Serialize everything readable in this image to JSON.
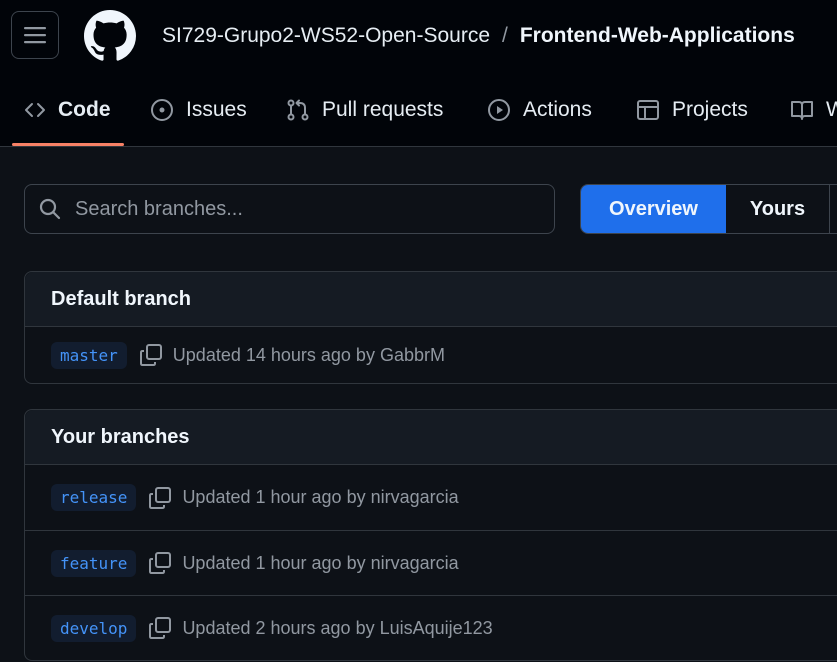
{
  "header": {
    "owner": "SI729-Grupo2-WS52-Open-Source",
    "separator": "/",
    "repo": "Frontend-Web-Applications",
    "menu_icon": "hamburger-icon",
    "logo_icon": "github-logo-icon"
  },
  "tabs": [
    {
      "label": "Code",
      "icon": "code-icon",
      "active": true
    },
    {
      "label": "Issues",
      "icon": "issue-opened-icon"
    },
    {
      "label": "Pull requests",
      "icon": "git-pull-request-icon"
    },
    {
      "label": "Actions",
      "icon": "play-icon"
    },
    {
      "label": "Projects",
      "icon": "table-icon"
    },
    {
      "label": "W",
      "icon": "book-icon"
    }
  ],
  "search": {
    "placeholder": "Search branches..."
  },
  "filter": {
    "selected": "Overview",
    "other": "Yours"
  },
  "default_branch": {
    "title": "Default branch",
    "rows": [
      {
        "name": "master",
        "updated": "Updated 14 hours ago by GabbrM"
      }
    ]
  },
  "your_branches": {
    "title": "Your branches",
    "rows": [
      {
        "name": "release",
        "updated": "Updated 1 hour ago by nirvagarcia"
      },
      {
        "name": "feature",
        "updated": "Updated 1 hour ago by nirvagarcia"
      },
      {
        "name": "develop",
        "updated": "Updated 2 hours ago by LuisAquije123"
      }
    ]
  },
  "colors": {
    "accent": "#1f6feb",
    "link": "#4493f8",
    "tab_underline": "#f78166"
  }
}
